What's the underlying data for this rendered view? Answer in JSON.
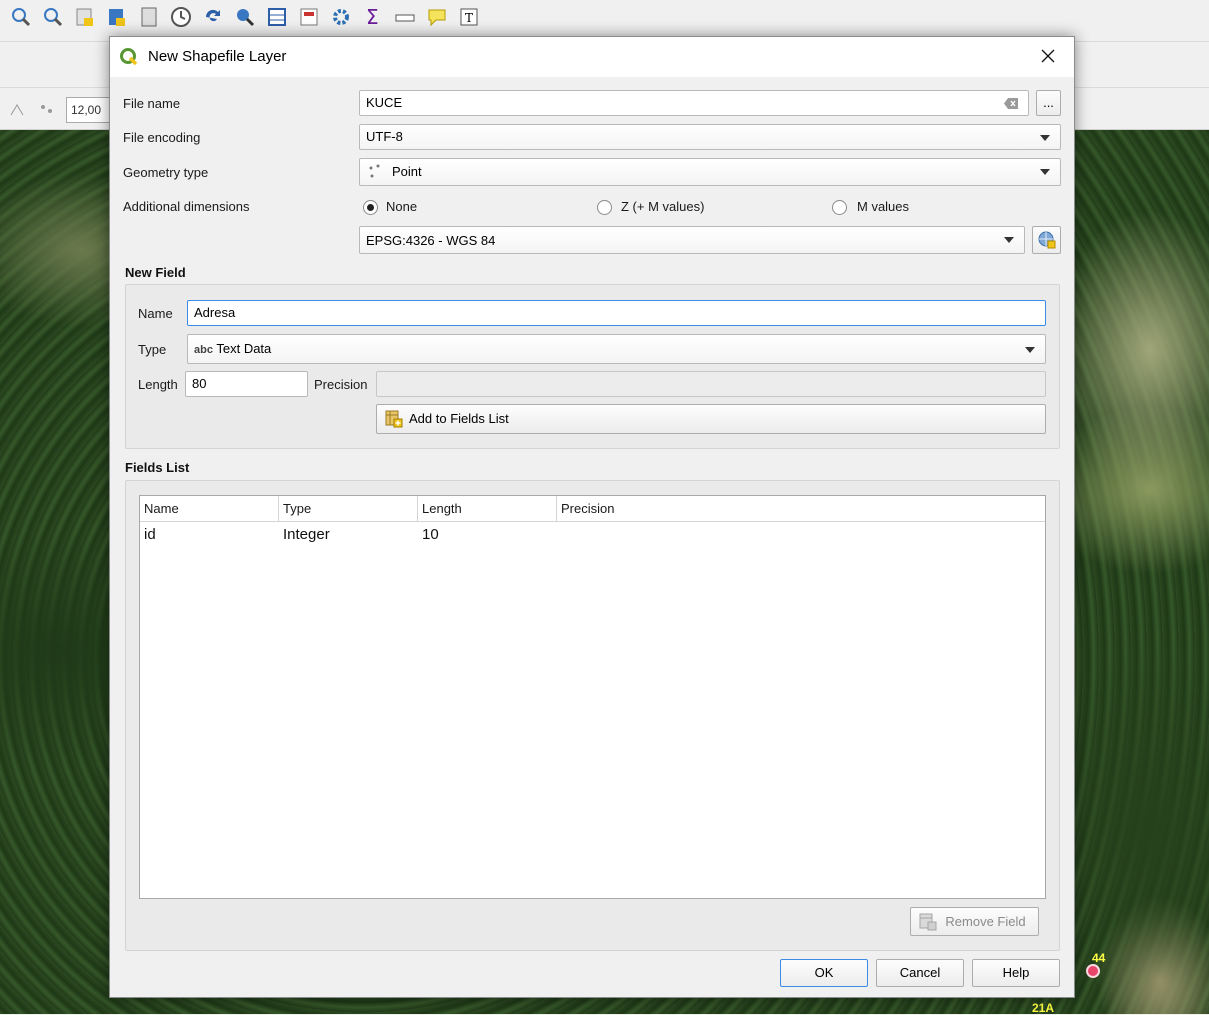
{
  "dialog": {
    "title": "New Shapefile Layer",
    "close_glyph": "✕",
    "file_name_label": "File name",
    "file_name_value": "KUCE",
    "browse_label": "...",
    "file_encoding_label": "File encoding",
    "file_encoding_value": "UTF-8",
    "geometry_type_label": "Geometry type",
    "geometry_type_value": "Point",
    "additional_dimensions_label": "Additional dimensions",
    "dimension_options": [
      "None",
      "Z (+ M values)",
      "M values"
    ],
    "dimension_selected": "None",
    "crs_value": "EPSG:4326 - WGS 84",
    "new_field": {
      "section_title": "New Field",
      "name_label": "Name",
      "name_value": "Adresa",
      "type_label": "Type",
      "type_value": "Text Data",
      "type_icon_text": "abc",
      "length_label": "Length",
      "length_value": "80",
      "precision_label": "Precision",
      "precision_value": "",
      "add_button_label": "Add to Fields List"
    },
    "fields_list": {
      "section_title": "Fields List",
      "columns": [
        "Name",
        "Type",
        "Length",
        "Precision"
      ],
      "rows": [
        {
          "name": "id",
          "type": "Integer",
          "length": "10",
          "precision": ""
        }
      ],
      "remove_button_label": "Remove Field"
    },
    "buttons": {
      "ok": "OK",
      "cancel": "Cancel",
      "help": "Help"
    }
  },
  "background": {
    "scale_value": "12,00",
    "map_labels": [
      "44",
      "21A"
    ]
  },
  "colors": {
    "accent_focus": "#3c8ce7",
    "qgis_green": "#589632",
    "qgis_yellow": "#f0c419",
    "marker": "#e8466a",
    "map_label": "#ffff44"
  },
  "icons": [
    "qgis-logo-icon",
    "close-icon",
    "clear-text-icon",
    "point-geometry-icon",
    "crs-select-icon",
    "add-field-icon",
    "remove-field-icon"
  ]
}
